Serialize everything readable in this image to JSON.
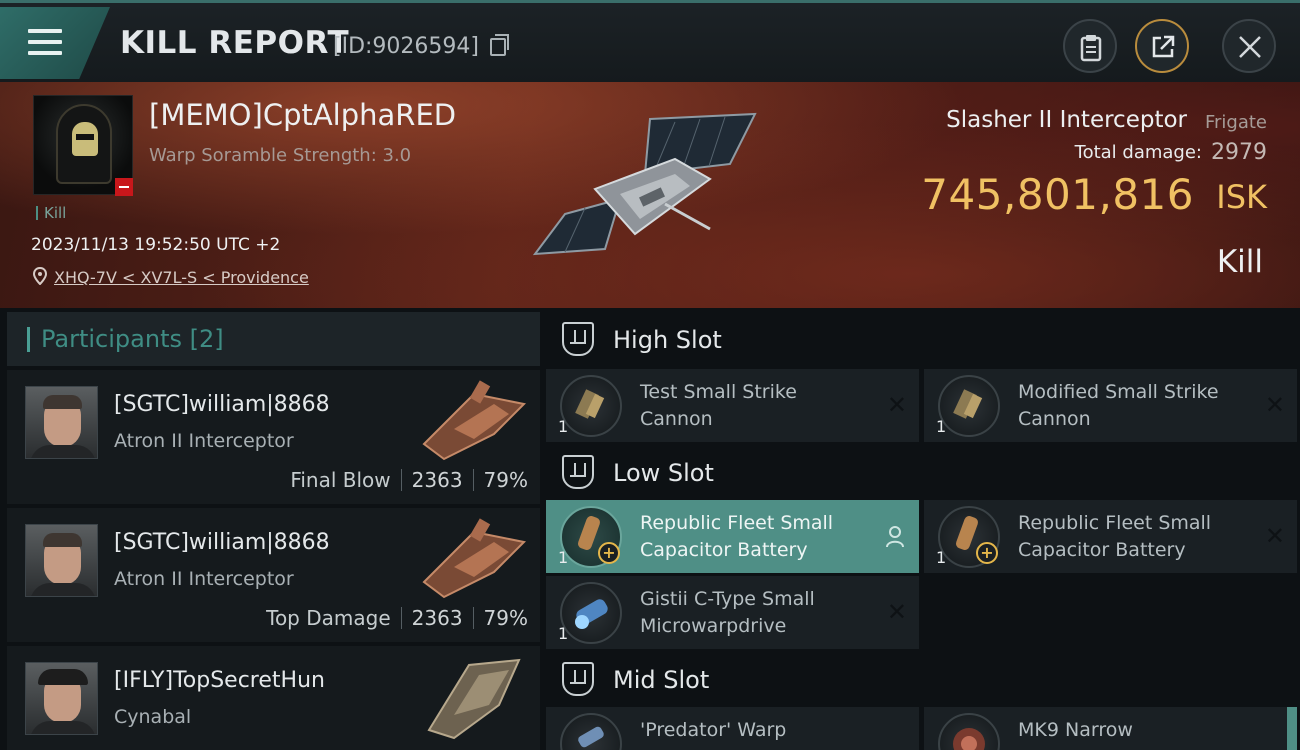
{
  "header": {
    "title": "KILL REPORT",
    "report_id": "[ID:9026594]"
  },
  "victim": {
    "name": "[MEMO]CptAlphaRED",
    "subtitle": "Warp Soramble Strength: 3.0",
    "tag": "Kill",
    "timestamp": "2023/11/13 19:52:50 UTC +2",
    "location": "XHQ-7V < XV7L-S < Providence",
    "ship_name": "Slasher II Interceptor",
    "ship_class": "Frigate",
    "damage_label": "Total damage:",
    "damage_value": "2979",
    "isk_value": "745,801,816",
    "isk_unit": "ISK",
    "result": "Kill"
  },
  "participants": {
    "header": "Participants",
    "count": "[2]",
    "rows": [
      {
        "name": "[SGTC]william|8868",
        "ship": "Atron II Interceptor",
        "label": "Final Blow",
        "damage": "2363",
        "percent": "79%"
      },
      {
        "name": "[SGTC]william|8868",
        "ship": "Atron II Interceptor",
        "label": "Top Damage",
        "damage": "2363",
        "percent": "79%"
      },
      {
        "name": "[IFLY]TopSecretHun",
        "ship": "Cynabal"
      }
    ]
  },
  "fitting": {
    "high_slot": "High Slot",
    "low_slot": "Low Slot",
    "mid_slot": "Mid Slot",
    "high": [
      {
        "name": "Test Small Strike Cannon",
        "qty": "1"
      },
      {
        "name": "Modified Small Strike Cannon",
        "qty": "1"
      }
    ],
    "low": [
      {
        "name": "Republic Fleet Small Capacitor Battery",
        "qty": "1"
      },
      {
        "name": "Republic Fleet Small Capacitor Battery",
        "qty": "1"
      },
      {
        "name": "Gistii C-Type Small Microwarpdrive",
        "qty": "1"
      }
    ],
    "mid": [
      {
        "name": "'Predator' Warp"
      },
      {
        "name": "MK9 Narrow"
      }
    ]
  },
  "colors": {
    "accent": "#4f8f86",
    "isk": "#f0c163",
    "banner": "#5c2419"
  }
}
